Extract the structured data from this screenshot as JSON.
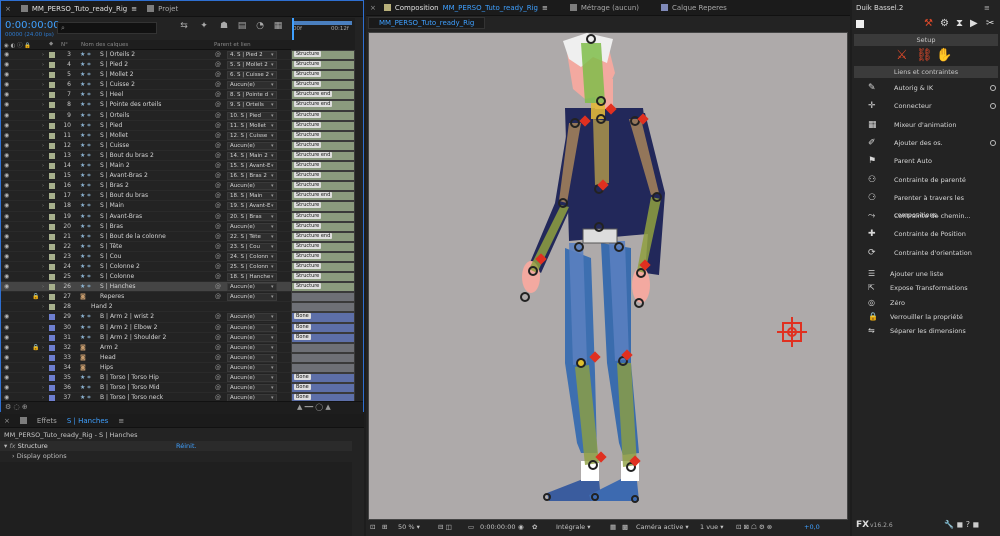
{
  "timeline": {
    "tab_label": "MM_PERSO_Tuto_ready_Rig",
    "project_tab": "Projet",
    "timecode": "0:00:00:00",
    "timecode_sub": "00000 (24.00 ips)",
    "search_placeholder": "⌕",
    "col_num": "N°",
    "col_name": "Nom des calques",
    "col_parent": "Parent et lien",
    "ruler_start": "00f",
    "ruler_end": "00:12f",
    "layers": [
      {
        "num": "3",
        "name": "S | Orteils 2",
        "parent": "4. S | Pied 2",
        "bar": "Structure",
        "sw": "#a7b08c",
        "fill": "#8b9b7e",
        "eye": true
      },
      {
        "num": "4",
        "name": "S | Pied 2",
        "parent": "5. S | Mollet 2",
        "bar": "Structure",
        "sw": "#a7b08c",
        "fill": "#8b9b7e",
        "eye": true
      },
      {
        "num": "5",
        "name": "S | Mollet 2",
        "parent": "6. S | Cuisse 2",
        "bar": "Structure",
        "sw": "#a7b08c",
        "fill": "#8b9b7e",
        "eye": true
      },
      {
        "num": "6",
        "name": "S | Cuisse 2",
        "parent": "Aucun(e)",
        "bar": "Structure",
        "sw": "#a7b08c",
        "fill": "#8b9b7e",
        "eye": true
      },
      {
        "num": "7",
        "name": "S | Heel",
        "parent": "8. S | Pointe d",
        "bar": "Structure end",
        "sw": "#a7b08c",
        "fill": "#8b9b7e",
        "eye": true
      },
      {
        "num": "8",
        "name": "S | Pointe des orteils",
        "parent": "9. S | Orteils",
        "bar": "Structure end",
        "sw": "#a7b08c",
        "fill": "#8b9b7e",
        "eye": true
      },
      {
        "num": "9",
        "name": "S | Orteils",
        "parent": "10. S | Pied",
        "bar": "Structure",
        "sw": "#a7b08c",
        "fill": "#8b9b7e",
        "eye": true
      },
      {
        "num": "10",
        "name": "S | Pied",
        "parent": "11. S | Mollet",
        "bar": "Structure",
        "sw": "#a7b08c",
        "fill": "#8b9b7e",
        "eye": true
      },
      {
        "num": "11",
        "name": "S | Mollet",
        "parent": "12. S | Cuisse",
        "bar": "Structure",
        "sw": "#a7b08c",
        "fill": "#8b9b7e",
        "eye": true
      },
      {
        "num": "12",
        "name": "S | Cuisse",
        "parent": "Aucun(e)",
        "bar": "Structure",
        "sw": "#a7b08c",
        "fill": "#8b9b7e",
        "eye": true
      },
      {
        "num": "13",
        "name": "S | Bout du bras 2",
        "parent": "14. S | Main 2",
        "bar": "Structure end",
        "sw": "#a7b08c",
        "fill": "#8b9b7e",
        "eye": true
      },
      {
        "num": "14",
        "name": "S | Main 2",
        "parent": "15. S | Avant-E",
        "bar": "Structure",
        "sw": "#a7b08c",
        "fill": "#8b9b7e",
        "eye": true
      },
      {
        "num": "15",
        "name": "S | Avant-Bras 2",
        "parent": "16. S | Bras 2",
        "bar": "Structure",
        "sw": "#a7b08c",
        "fill": "#8b9b7e",
        "eye": true
      },
      {
        "num": "16",
        "name": "S | Bras 2",
        "parent": "Aucun(e)",
        "bar": "Structure",
        "sw": "#a7b08c",
        "fill": "#8b9b7e",
        "eye": true
      },
      {
        "num": "17",
        "name": "S | Bout du bras",
        "parent": "18. S | Main",
        "bar": "Structure end",
        "sw": "#a7b08c",
        "fill": "#8b9b7e",
        "eye": true
      },
      {
        "num": "18",
        "name": "S | Main",
        "parent": "19. S | Avant-E",
        "bar": "Structure",
        "sw": "#a7b08c",
        "fill": "#8b9b7e",
        "eye": true
      },
      {
        "num": "19",
        "name": "S | Avant-Bras",
        "parent": "20. S | Bras",
        "bar": "Structure",
        "sw": "#a7b08c",
        "fill": "#8b9b7e",
        "eye": true
      },
      {
        "num": "20",
        "name": "S | Bras",
        "parent": "Aucun(e)",
        "bar": "Structure",
        "sw": "#a7b08c",
        "fill": "#8b9b7e",
        "eye": true
      },
      {
        "num": "21",
        "name": "S | Bout de la colonne",
        "parent": "22. S | Tête",
        "bar": "Structure end",
        "sw": "#a7b08c",
        "fill": "#8b9b7e",
        "eye": true
      },
      {
        "num": "22",
        "name": "S | Tête",
        "parent": "23. S | Cou",
        "bar": "Structure",
        "sw": "#a7b08c",
        "fill": "#8b9b7e",
        "eye": true
      },
      {
        "num": "23",
        "name": "S | Cou",
        "parent": "24. S | Colonn",
        "bar": "Structure",
        "sw": "#a7b08c",
        "fill": "#8b9b7e",
        "eye": true
      },
      {
        "num": "24",
        "name": "S | Colonne 2",
        "parent": "25. S | Colonn",
        "bar": "Structure",
        "sw": "#a7b08c",
        "fill": "#8b9b7e",
        "eye": true
      },
      {
        "num": "25",
        "name": "S | Colonne",
        "parent": "18. S | Hanche",
        "bar": "Structure",
        "sw": "#a7b08c",
        "fill": "#8b9b7e",
        "eye": true
      },
      {
        "num": "26",
        "name": "S | Hanches",
        "parent": "Aucun(e)",
        "bar": "Structure",
        "sw": "#a7b08c",
        "fill": "#8b9b7e",
        "eye": true,
        "selected": true
      },
      {
        "num": "27",
        "name": "Reperes",
        "parent": "Aucun(e)",
        "bar": "",
        "sw": "#a7b08c",
        "fill": "#6e7076",
        "eye": false,
        "lock": true,
        "icon": "avatar"
      },
      {
        "num": "28",
        "name": "Hand 2",
        "parent": "",
        "bar": "",
        "sw": "#a7b08c",
        "fill": "#6e7076",
        "eye": false,
        "icon": "none"
      },
      {
        "num": "29",
        "name": "B | Arm 2 | wrist 2",
        "parent": "Aucun(e)",
        "bar": "Bone",
        "sw": "#6e7fd0",
        "fill": "#5d6fa8",
        "eye": true
      },
      {
        "num": "30",
        "name": "B | Arm 2 | Elbow 2",
        "parent": "Aucun(e)",
        "bar": "Bone",
        "sw": "#6e7fd0",
        "fill": "#5d6fa8",
        "eye": true
      },
      {
        "num": "31",
        "name": "B | Arm 2 | Shoulder 2",
        "parent": "Aucun(e)",
        "bar": "Bone",
        "sw": "#6e7fd0",
        "fill": "#5d6fa8",
        "eye": true
      },
      {
        "num": "32",
        "name": "Arm 2",
        "parent": "Aucun(e)",
        "bar": "",
        "sw": "#6e7fd0",
        "fill": "#6e7076",
        "eye": true,
        "lock": true,
        "icon": "avatar"
      },
      {
        "num": "33",
        "name": "Head",
        "parent": "Aucun(e)",
        "bar": "",
        "sw": "#6e7fd0",
        "fill": "#6e7076",
        "eye": true,
        "icon": "avatar"
      },
      {
        "num": "34",
        "name": "Hips",
        "parent": "Aucun(e)",
        "bar": "",
        "sw": "#6e7fd0",
        "fill": "#6e7076",
        "eye": true,
        "icon": "avatar"
      },
      {
        "num": "35",
        "name": "B | Torso | Torso Hip",
        "parent": "Aucun(e)",
        "bar": "Bone",
        "sw": "#6e7fd0",
        "fill": "#5d6fa8",
        "eye": true
      },
      {
        "num": "36",
        "name": "B | Torso | Torso Mid",
        "parent": "Aucun(e)",
        "bar": "Bone",
        "sw": "#6e7fd0",
        "fill": "#5d6fa8",
        "eye": true
      },
      {
        "num": "37",
        "name": "B | Torso | Torso neck",
        "parent": "Aucun(e)",
        "bar": "Bone",
        "sw": "#6e7fd0",
        "fill": "#5d6fa8",
        "eye": true
      }
    ]
  },
  "effects": {
    "tab_prefix": "Effets",
    "tab_layer": "S | Hanches",
    "path": "MM_PERSO_Tuto_ready_Rig - S | Hanches",
    "fx_label": "fx",
    "effect_name": "Structure",
    "reset": "Réinit.",
    "sub": "Display options"
  },
  "composition": {
    "tab_prefix": "Composition",
    "tab_name": "MM_PERSO_Tuto_ready_Rig",
    "footage_tab": "Métrage (aucun)",
    "layer_tab": "Calque Reperes",
    "comp_tab_label": "MM_PERSO_Tuto_ready_Rig",
    "zoom": "50 %",
    "timecode": "0:00:00:00",
    "quality": "Intégrale",
    "camera": "Caméra active",
    "views": "1 vue",
    "exposure": "+0,0"
  },
  "duik": {
    "title": "Duik Bassel.2",
    "setup": "Setup",
    "links_header": "Liens et contraintes",
    "items": [
      {
        "label": "Autorig & IK",
        "dot": true
      },
      {
        "label": "Connecteur",
        "dot": true
      },
      {
        "label": "Mixeur d'animation",
        "dot": false
      },
      {
        "label": "Ajouter des os.",
        "dot": true
      },
      {
        "label": "Parent Auto",
        "dot": false
      },
      {
        "label": "Contrainte de parenté",
        "dot": false
      },
      {
        "label": "Parenter à travers les compositions.",
        "dot": false
      },
      {
        "label": "Contrainte de chemin...",
        "dot": false
      },
      {
        "label": "Contrainte de Position",
        "dot": false
      },
      {
        "label": "Contrainte d'orientation",
        "dot": false
      }
    ],
    "tools": [
      {
        "label": "Ajouter une liste"
      },
      {
        "label": "Expose Transformations"
      },
      {
        "label": "Zéro"
      },
      {
        "label": "Verrouiller la propriété"
      },
      {
        "label": "Séparer les dimensions"
      }
    ],
    "version": "v16.2.6",
    "fx_logo": "FX"
  }
}
